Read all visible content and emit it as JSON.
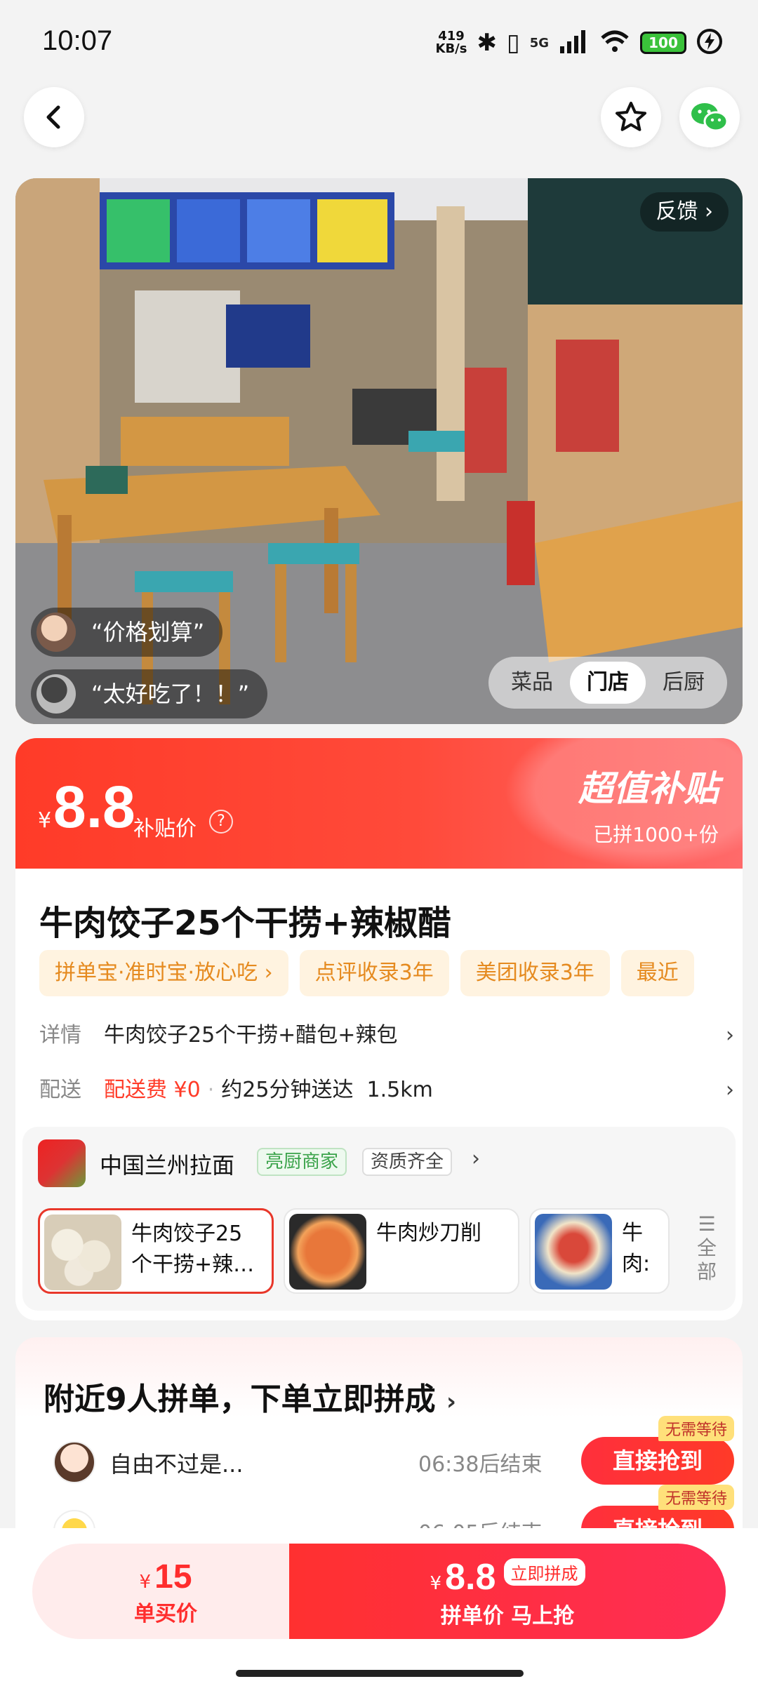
{
  "status": {
    "time": "10:07",
    "net_speed_top": "419",
    "net_speed_unit": "KB/s",
    "network": "5G",
    "battery": "100"
  },
  "header": {
    "back_icon": "chevron-left-icon",
    "favorite_icon": "star-icon",
    "share_icon": "wechat-icon"
  },
  "hero": {
    "feedback_label": "反馈",
    "quote1": "“价格划算”",
    "quote2": "“太好吃了！！”",
    "tabs": [
      "菜品",
      "门店",
      "后厨"
    ],
    "active_tab": "门店"
  },
  "price": {
    "yen": "¥",
    "amount": "8.8",
    "label": "补贴价",
    "help": "?",
    "promo_title": "超值补贴",
    "joined": "已拼1000+份",
    "accent_color": "#ff3b28"
  },
  "product": {
    "title": "牛肉饺子25个干捞+辣椒醋",
    "tags": [
      "拼单宝·准时宝·放心吃 ›",
      "点评收录3年",
      "美团收录3年",
      "最近"
    ],
    "detail_label": "详情",
    "detail_value": "牛肉饺子25个干捞+醋包+辣包",
    "delivery_label": "配送",
    "delivery_fee": "配送费 ¥0",
    "delivery_dot": "·",
    "delivery_time": "约25分钟送达",
    "delivery_distance": "1.5km"
  },
  "shop": {
    "name": "中国兰州拉面",
    "badge_kitchen": "亮厨商家",
    "badge_qualified": "资质齐全",
    "dishes": [
      {
        "name": "牛肉饺子25个干捞+辣…",
        "selected": true
      },
      {
        "name": "牛肉炒刀削",
        "selected": false
      },
      {
        "name": "牛肉:",
        "selected": false
      }
    ],
    "all_label": "全部"
  },
  "group": {
    "title": "附近9人拼单，下单立即拼成",
    "rows": [
      {
        "user": "自由不过是...",
        "ends": "06:38后结束",
        "button": "直接抢到",
        "tip": "无需等待"
      },
      {
        "user": "...",
        "ends": "06:05后结束",
        "button": "直接抢到",
        "tip": "无需等待"
      }
    ]
  },
  "bottom": {
    "single_yen": "¥",
    "single_price": "15",
    "single_label": "单买价",
    "group_yen": "¥",
    "group_price": "8.8",
    "group_tag": "立即拼成",
    "group_label": "拼单价 马上抢"
  }
}
